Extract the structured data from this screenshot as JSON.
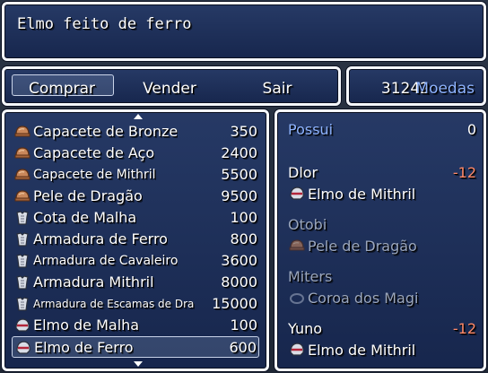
{
  "help": {
    "text": "Elmo feito de ferro"
  },
  "commands": [
    {
      "label": "Comprar"
    },
    {
      "label": "Vender"
    },
    {
      "label": "Sair"
    }
  ],
  "gold": {
    "amount": "31242",
    "unit": "Moedas"
  },
  "items": [
    {
      "name": "Capacete de Bronze",
      "price": "350",
      "icon": "helmet-icon"
    },
    {
      "name": "Capacete de Aço",
      "price": "2400",
      "icon": "helmet-icon"
    },
    {
      "name": "Capacete de Mithril",
      "price": "5500",
      "icon": "helmet-icon"
    },
    {
      "name": "Pele de Dragão",
      "price": "9500",
      "icon": "helmet-icon"
    },
    {
      "name": "Cota de Malha",
      "price": "100",
      "icon": "armor-icon"
    },
    {
      "name": "Armadura de Ferro",
      "price": "800",
      "icon": "armor-icon"
    },
    {
      "name": "Armadura de Cavaleiro",
      "price": "3600",
      "icon": "armor-icon"
    },
    {
      "name": "Armadura Mithril",
      "price": "8000",
      "icon": "armor-icon"
    },
    {
      "name": "Armadura de Escamas de Dragão",
      "price": "15000",
      "icon": "armor-icon"
    },
    {
      "name": "Elmo de Malha",
      "price": "100",
      "icon": "helm-icon"
    },
    {
      "name": "Elmo de Ferro",
      "price": "600",
      "icon": "helm-icon"
    }
  ],
  "status": {
    "possess_label": "Possui",
    "possess_value": "0",
    "actors": [
      {
        "name": "Dlor",
        "diff": "-12",
        "equip": "Elmo de Mithril",
        "enabled": true
      },
      {
        "name": "Otobi",
        "diff": "",
        "equip": "Pele de Dragão",
        "enabled": false
      },
      {
        "name": "Miters",
        "diff": "",
        "equip": "Coroa dos Magi",
        "enabled": false
      },
      {
        "name": "Yuno",
        "diff": "-12",
        "equip": "Elmo de Mithril",
        "enabled": true
      }
    ]
  },
  "colors": {
    "system": "#8fb4ff",
    "negative": "#ff8a6a",
    "disabled": "#9aa6bd"
  }
}
